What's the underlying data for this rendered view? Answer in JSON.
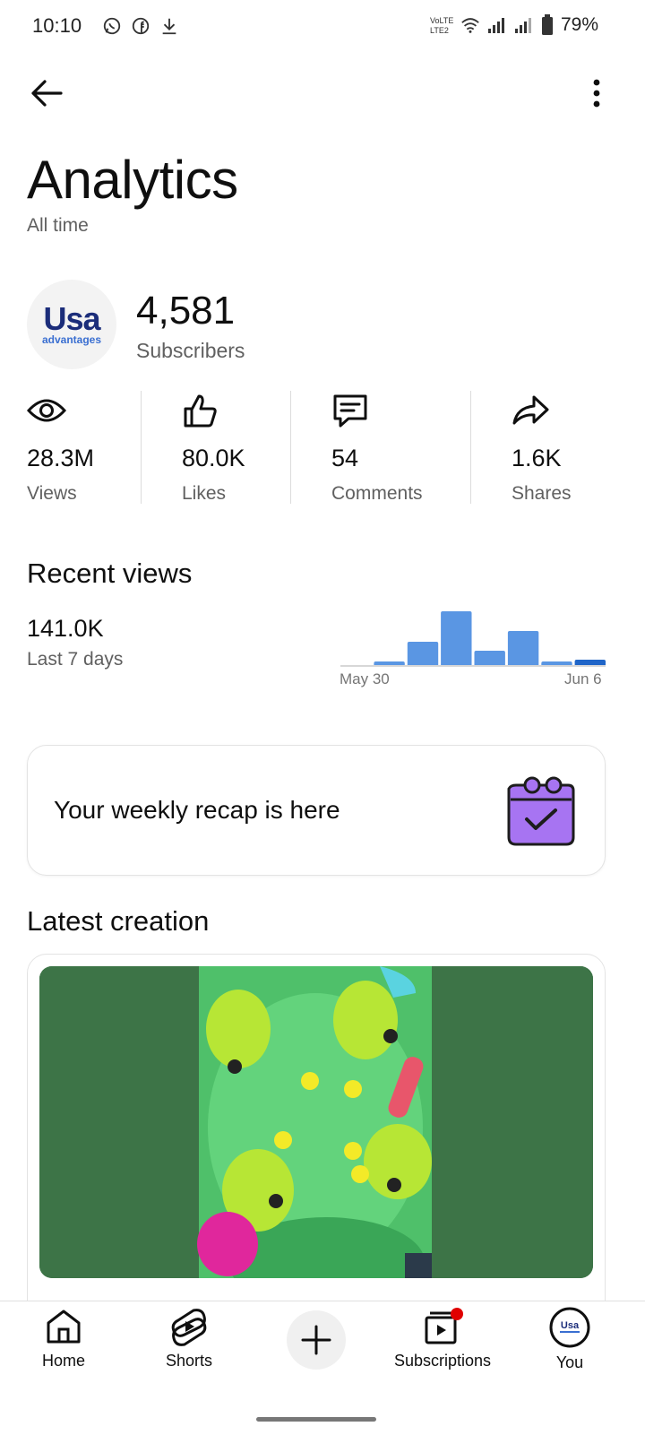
{
  "status_bar": {
    "time": "10:10",
    "left_icons": [
      "whatsapp-icon",
      "facebook-icon",
      "download-icon"
    ],
    "right_icons": [
      "volte-icon",
      "wifi-icon",
      "signal-icon",
      "signal-icon",
      "battery-icon"
    ],
    "battery": "79%"
  },
  "header": {
    "back_icon": "arrow-left-icon",
    "more_icon": "more-vert-icon"
  },
  "page": {
    "title": "Analytics",
    "subtitle": "All time"
  },
  "channel": {
    "logo_text": "Usa",
    "logo_subtext": "advantages",
    "subscribers": "4,581",
    "subscribers_label": "Subscribers"
  },
  "stats": [
    {
      "icon": "eye-icon",
      "value": "28.3M",
      "label": "Views"
    },
    {
      "icon": "thumbs-up-icon",
      "value": "80.0K",
      "label": "Likes"
    },
    {
      "icon": "comment-icon",
      "value": "54",
      "label": "Comments"
    },
    {
      "icon": "share-icon",
      "value": "1.6K",
      "label": "Shares"
    }
  ],
  "recent_views": {
    "title": "Recent views",
    "value": "141.0K",
    "label": "Last 7 days"
  },
  "chart_data": {
    "type": "bar",
    "x_tick_labels": [
      "May 30",
      "Jun 6"
    ],
    "values": [
      2,
      6,
      28,
      62,
      18,
      40,
      6,
      8
    ],
    "colors": [
      "#cfcfcf",
      "#5a96e3",
      "#5a96e3",
      "#5a96e3",
      "#5a96e3",
      "#5a96e3",
      "#5a96e3",
      "#1f65c8"
    ]
  },
  "recap": {
    "text": "Your weekly recap is here",
    "icon": "calendar-check-icon"
  },
  "latest_creation": {
    "title": "Latest creation"
  },
  "bottom_nav": {
    "items": [
      {
        "label": "Home",
        "icon": "home-icon"
      },
      {
        "label": "Shorts",
        "icon": "shorts-icon"
      },
      {
        "label": "Subscriptions",
        "icon": "subscriptions-icon"
      },
      {
        "label": "You",
        "icon": "avatar-icon"
      }
    ],
    "create_icon": "plus-icon",
    "you_logo_text": "Usa",
    "notification_color": "#e00000"
  }
}
